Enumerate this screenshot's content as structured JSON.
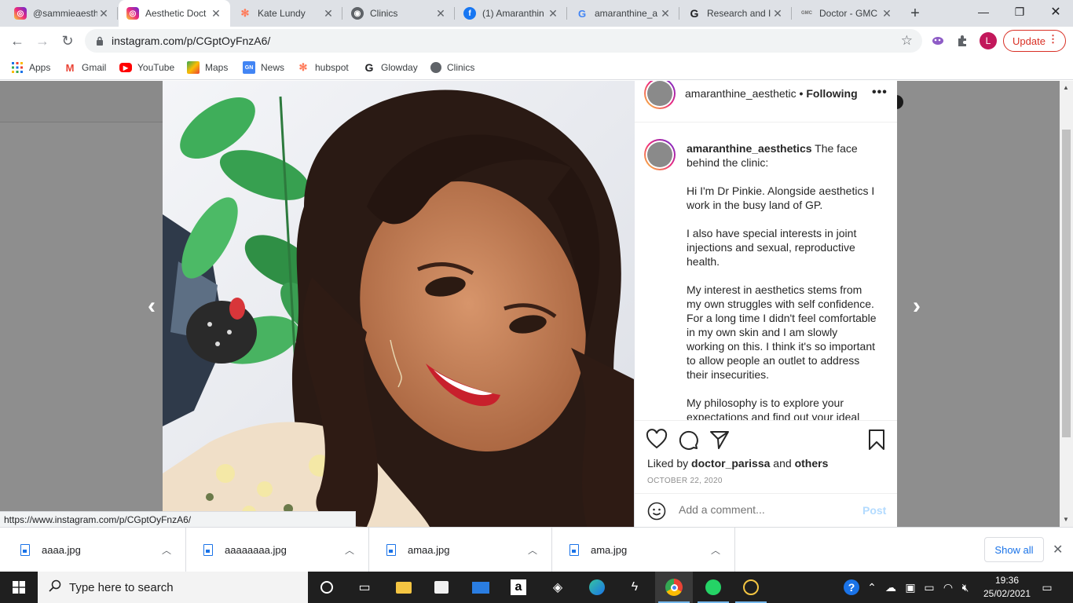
{
  "browser": {
    "tabs": [
      {
        "label": "@sammieaesth",
        "icon": "instagram-icon",
        "active": false
      },
      {
        "label": "Aesthetic Doct",
        "icon": "instagram-icon",
        "active": true
      },
      {
        "label": "Kate Lundy",
        "icon": "hubspot-icon",
        "active": false
      },
      {
        "label": "Clinics",
        "icon": "globe-icon",
        "active": false
      },
      {
        "label": "(1) Amaranthin",
        "icon": "facebook-icon",
        "active": false
      },
      {
        "label": "amaranthine_a",
        "icon": "google-icon",
        "active": false
      },
      {
        "label": "Research and I",
        "icon": "glowday-icon",
        "active": false
      },
      {
        "label": "Doctor - GMC",
        "icon": "gmc-icon",
        "active": false
      }
    ],
    "url": "instagram.com/p/CGptOyFnzA6/",
    "profile_initial": "L",
    "update_label": "Update",
    "bookmarks": [
      {
        "label": "Apps",
        "icon": "apps-grid-icon"
      },
      {
        "label": "Gmail",
        "icon": "gmail-icon"
      },
      {
        "label": "YouTube",
        "icon": "youtube-icon"
      },
      {
        "label": "Maps",
        "icon": "maps-icon"
      },
      {
        "label": "News",
        "icon": "news-icon"
      },
      {
        "label": "hubspot",
        "icon": "hubspot-icon"
      },
      {
        "label": "Glowday",
        "icon": "glowday-icon"
      },
      {
        "label": "Clinics",
        "icon": "globe-icon"
      }
    ],
    "status_url": "https://www.instagram.com/p/CGptOyFnzA6/"
  },
  "post": {
    "username": "amaranthine_aesthetic",
    "following_label": "• Following",
    "caption_user": "amaranthine_aesthetics",
    "caption_intro": " The face behind the clinic:",
    "paragraphs": [
      "Hi I'm Dr Pinkie. Alongside aesthetics I work in the busy land of GP.",
      "I also have special interests in joint injections and sexual, reproductive health.",
      "My interest in aesthetics stems from my own struggles with self confidence. For a long time I didn't feel comfortable in my own skin and I am slowly working on this. I think it's so important to allow people an outlet to address their insecurities.",
      "My philosophy is to explore your expectations and find out your ideal"
    ],
    "liked_prefix": "Liked by ",
    "liked_user": "doctor_parissa",
    "liked_and": " and ",
    "liked_others": "others",
    "date": "OCTOBER 22, 2020",
    "comment_placeholder": "Add a comment...",
    "post_label": "Post"
  },
  "downloads": {
    "items": [
      "aaaa.jpg",
      "aaaaaaaa.jpg",
      "amaa.jpg",
      "ama.jpg"
    ],
    "show_all_label": "Show all"
  },
  "taskbar": {
    "search_placeholder": "Type here to search",
    "time": "19:36",
    "date": "25/02/2021"
  },
  "colors": {
    "instagram_gradient": [
      "#f9ce34",
      "#ee2a7b",
      "#6228d7"
    ],
    "update_red": "#d93025",
    "link_blue": "#1a73e8"
  }
}
